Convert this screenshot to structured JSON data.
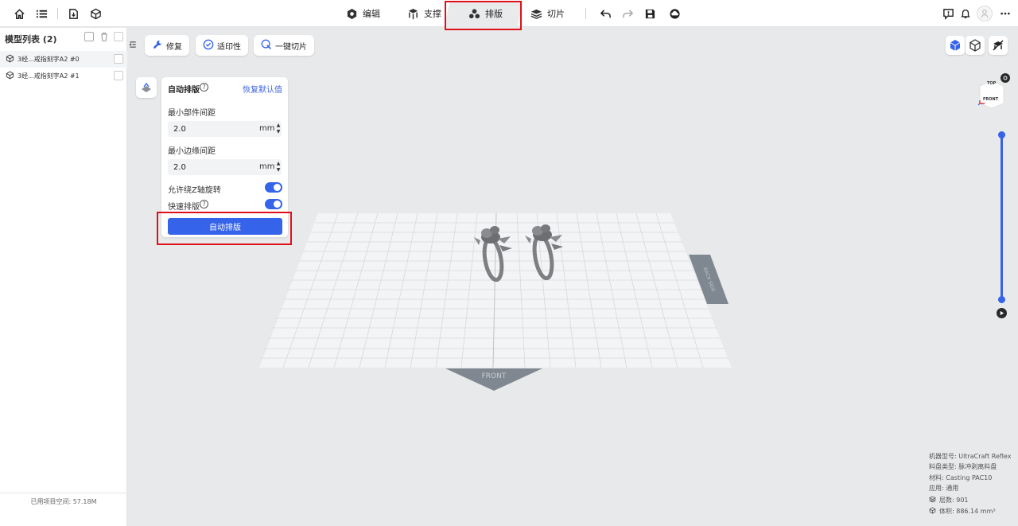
{
  "topbar": {
    "tabs": [
      {
        "label": "编辑",
        "icon": "edit-hexagon-icon"
      },
      {
        "label": "支撑",
        "icon": "support-icon"
      },
      {
        "label": "排版",
        "icon": "layout-icon",
        "active": true
      },
      {
        "label": "切片",
        "icon": "slice-layers-icon"
      }
    ]
  },
  "sidebar": {
    "title": "模型列表 (2)",
    "items": [
      {
        "label": "3经...戒指刻字A2 #0"
      },
      {
        "label": "3经...戒指刻字A2 #1"
      }
    ],
    "footer": "已用项目空间: 57.18M"
  },
  "toolbar": {
    "repair_label": "修复",
    "printability_label": "适印性",
    "one_click_slice_label": "一键切片"
  },
  "panel": {
    "title": "自动排版",
    "reset_label": "恢复默认值",
    "min_part_spacing_label": "最小部件间距",
    "min_part_spacing_value": "2.0",
    "min_edge_spacing_label": "最小边缘间距",
    "min_edge_spacing_value": "2.0",
    "unit": "mm",
    "allow_z_rotation_label": "允许绕Z轴旋转",
    "allow_z_rotation": true,
    "fast_layout_label": "快速排版",
    "fast_layout": true,
    "auto_layout_button": "自动排版"
  },
  "viewport": {
    "front_label": "FRONT",
    "side_label": "BACK SIDE",
    "cube_top": "TOP",
    "cube_front": "FRONT"
  },
  "info": {
    "machine": "机器型号: UltraCraft Reflex",
    "tray": "料盘类型: 脉冲剥离料盘",
    "material": "材料: Casting PAC10",
    "application": "应用: 通用",
    "layers": "层数: 901",
    "volume": "体积: 886.14 mm³"
  },
  "colors": {
    "accent": "#3563e9",
    "highlight": "#e0101a"
  }
}
